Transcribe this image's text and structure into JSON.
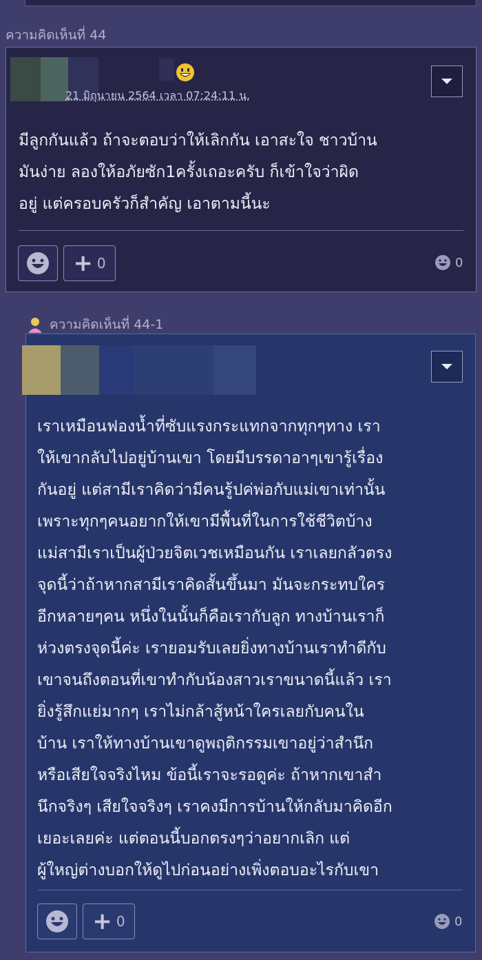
{
  "comment44": {
    "label": "ความคิดเห็นที่ 44",
    "date": "21 มิถุนายน 2564 เวลา 07:24:11 น.",
    "text": "มีลูกกันแล้ว ถ้าจะตอบว่าให้เลิกกัน เอาสะใจ ชาวบ้าน\nมันง่าย    ลองให้อภัยซัก1ครั้งเถอะครับ ก็เข้าใจว่าผิด\nอยู่ แต่ครอบครัวก็สำคัญ เอาตามนี้นะ",
    "plus_count": "0",
    "emotion_count": "0"
  },
  "reply44_1": {
    "label": "ความคิดเห็นที่ 44-1",
    "text": "เราเหมือนฟองน้ำที่ซับแรงกระแทกจากทุกๆทาง เรา\nให้เขากลับไปอยู่บ้านเขา โดยมีบรรดาอาๆเขารู้เรื่อง\nกันอยู่ แต่สามีเราคิดว่ามีคนรู้ปค่พ่อกับแม่เขาเท่านั้น\nเพราะทุกๆคนอยากให้เขามีพื้นที่ในการใช้ชีวิตบ้าง\nแม่สามีเราเป็นผู้ป่วยจิตเวชเหมือนกัน เราเลยกลัวตรง\nจุดนี้ว่าถ้าหากสามีเราคิดสั้นขึ้นมา มันจะกระทบใคร\nอีกหลายๆคน หนึ่งในนั้นก็คือเรากับลูก ทางบ้านเราก็\nห่วงตรงจุดนี้ค่ะ เรายอมรับเลยยิ่งทางบ้านเราทำดีกับ\nเขาจนถึงตอนที่เขาทำกับน้องสาวเราขนาดนี้แล้ว เรา\nยิ่งรู้สึกแย่มากๆ เราไม่กล้าสู้หน้าใครเลยกับคนใน\nบ้าน เราให้ทางบ้านเขาดูพฤติกรรมเขาอยู่ว่าสำนึก\nหรือเสียใจจริงไหม ข้อนี้เราจะรอดูค่ะ ถ้าหากเขาสำ\nนึกจริงๆ เสียใจจริงๆ เราคงมีการบ้านให้กลับมาคิดอีก\nเยอะเลยค่ะ แต่ตอนนี้บอกตรงๆว่าอยากเลิก แต่\nผู้ใหญ่ต่างบอกให้ดูไปก่อนอย่างเพิ่งตอบอะไรกับเขา",
    "plus_count": "0",
    "emotion_count": "0"
  },
  "colors": {
    "background": "#3e3d6b",
    "card": "#262548",
    "border": "#6a6a9a",
    "label_text": "#b5b1cf",
    "emoji_yellow": "#f2c230"
  },
  "icons": {
    "dropdown": "chevron-down-icon",
    "emotion": "smiley-icon",
    "plus": "plus-icon",
    "avatar_emoji": "grinning-emoji-icon",
    "member_badge": "person-icon"
  }
}
